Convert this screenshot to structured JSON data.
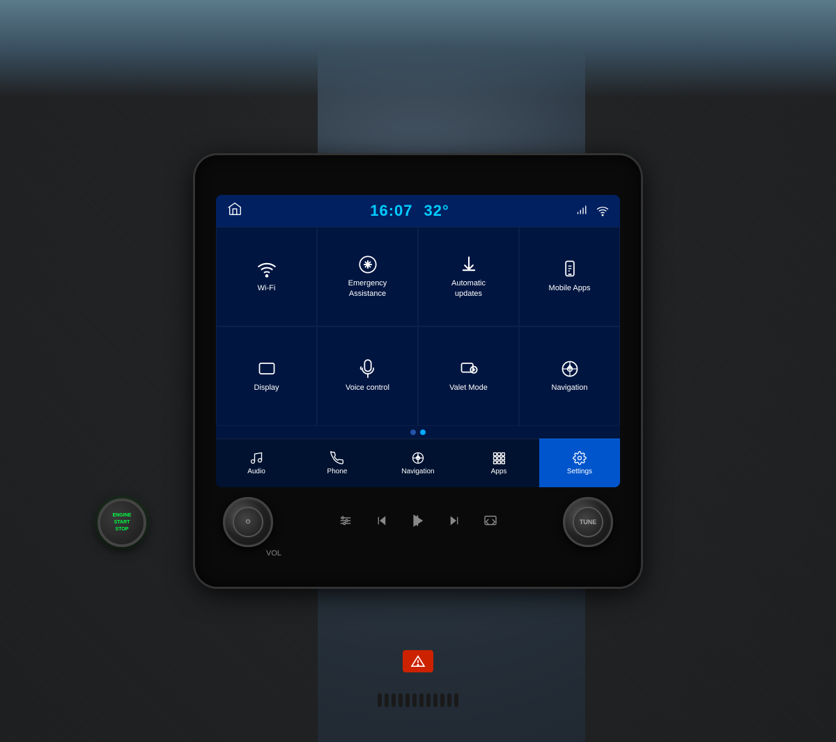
{
  "header": {
    "time": "16:07",
    "temp": "32°",
    "home_label": "home"
  },
  "grid_page1": [
    {
      "id": "wifi",
      "icon": "wifi",
      "label": "Wi-Fi"
    },
    {
      "id": "emergency",
      "icon": "emergency",
      "label": "Emergency\nAssistance"
    },
    {
      "id": "updates",
      "icon": "download",
      "label": "Automatic\nupdates"
    },
    {
      "id": "mobile_apps",
      "icon": "mobile",
      "label": "Mobile Apps"
    },
    {
      "id": "display",
      "icon": "display",
      "label": "Display"
    },
    {
      "id": "voice",
      "icon": "voice",
      "label": "Voice control"
    },
    {
      "id": "valet",
      "icon": "valet",
      "label": "Valet Mode"
    },
    {
      "id": "navigation",
      "icon": "nav",
      "label": "Navigation"
    }
  ],
  "nav_bar": [
    {
      "id": "audio",
      "icon": "music",
      "label": "Audio",
      "active": false
    },
    {
      "id": "phone",
      "icon": "phone",
      "label": "Phone",
      "active": false
    },
    {
      "id": "navigation",
      "icon": "nav",
      "label": "Navigation",
      "active": false
    },
    {
      "id": "apps",
      "icon": "apps",
      "label": "Apps",
      "active": false
    },
    {
      "id": "settings",
      "icon": "settings",
      "label": "Settings",
      "active": true
    }
  ],
  "controls": {
    "vol_label": "VOL",
    "tune_label": "TUNE"
  },
  "engine": {
    "line1": "ENGINE",
    "line2": "START",
    "line3": "STOP"
  },
  "dots": {
    "total": 2,
    "active": 1
  }
}
